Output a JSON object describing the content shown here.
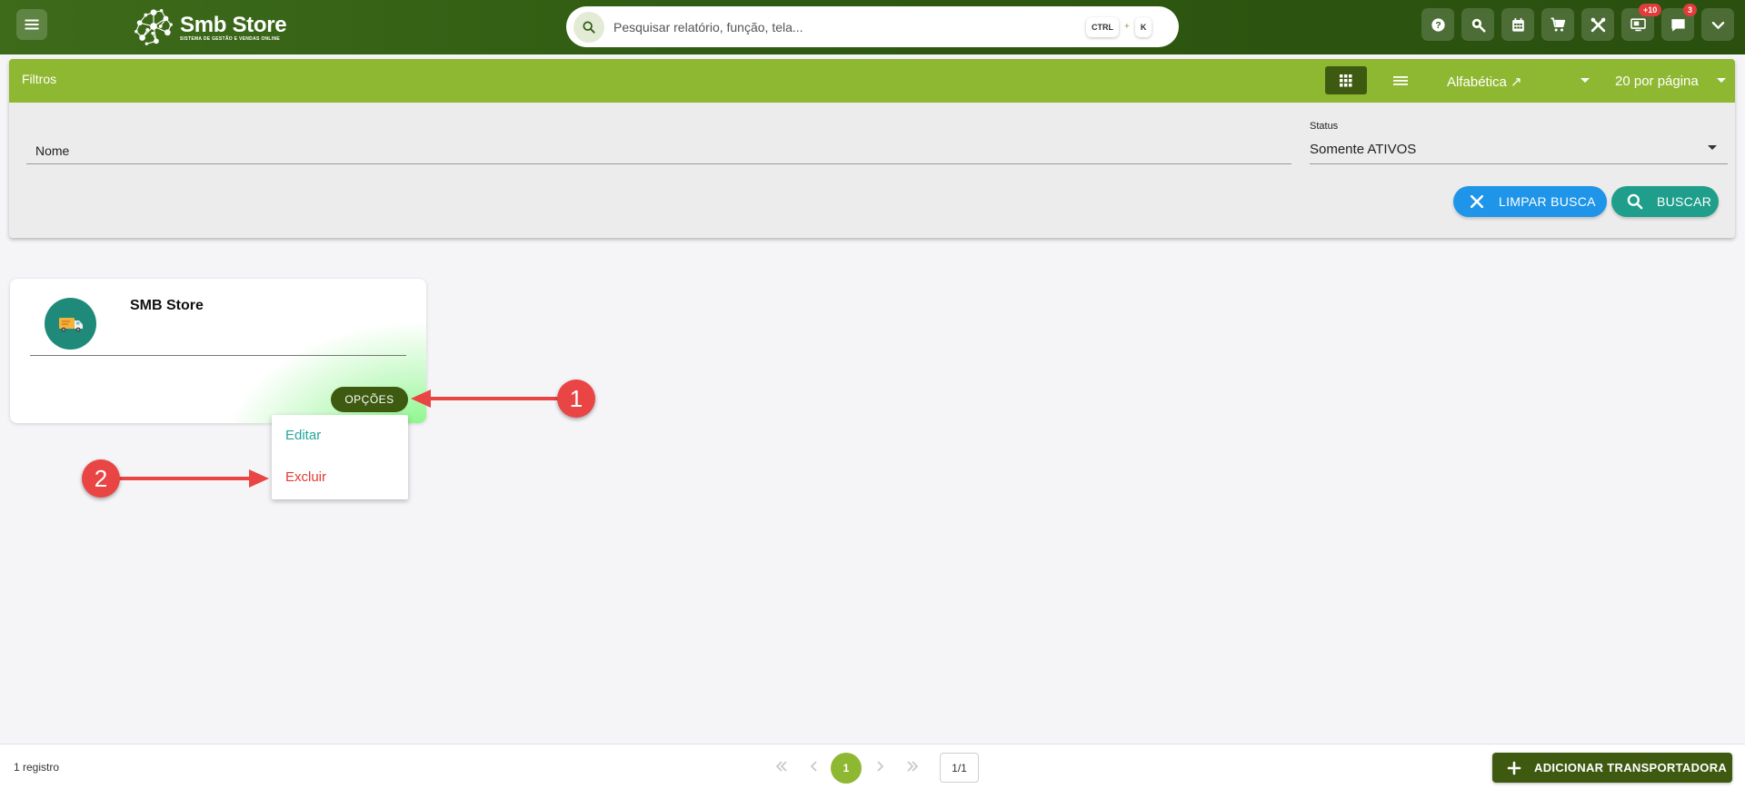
{
  "header": {
    "brand_title": "Smb Store",
    "brand_subtitle": "SISTEMA DE GESTÃO E VENDAS ONLINE",
    "search": {
      "placeholder": "Pesquisar relatório, função, tela...",
      "shortcut_key1": "CTRL",
      "shortcut_plus": "+",
      "shortcut_key2": "K"
    },
    "icons": [
      {
        "name": "help-icon"
      },
      {
        "name": "zoom-search-icon"
      },
      {
        "name": "calendar-icon"
      },
      {
        "name": "cart-icon"
      },
      {
        "name": "tools-icon"
      },
      {
        "name": "monitor-notification-icon",
        "badge": "+10"
      },
      {
        "name": "chat-icon",
        "badge": "3"
      },
      {
        "name": "chevron-down-icon"
      }
    ]
  },
  "filters": {
    "title": "Filtros",
    "sort_value": "Alfabética ↗",
    "per_page_value": "20 por página",
    "name_label": "Nome",
    "status_label": "Status",
    "status_value": "Somente ATIVOS",
    "clear_button": "LIMPAR BUSCA",
    "search_button": "BUSCAR"
  },
  "card": {
    "title": "SMB Store",
    "options_button": "OPÇÕES",
    "menu": {
      "edit": "Editar",
      "delete": "Excluir"
    }
  },
  "annotations": {
    "step1": "1",
    "step2": "2"
  },
  "footer": {
    "records": "1 registro",
    "current_page": "1",
    "page_of": "1/1",
    "add_button": "ADICIONAR TRANSPORTADORA"
  },
  "colors": {
    "header_green": "#2f5a12",
    "filter_bar_green": "#8fb832",
    "dark_olive": "#3e5a10",
    "blue_button": "#1e95e8",
    "teal_button": "#1f9e8c",
    "annotation_red": "#ea4545",
    "edit_teal": "#26a69a",
    "delete_red": "#e53935"
  }
}
